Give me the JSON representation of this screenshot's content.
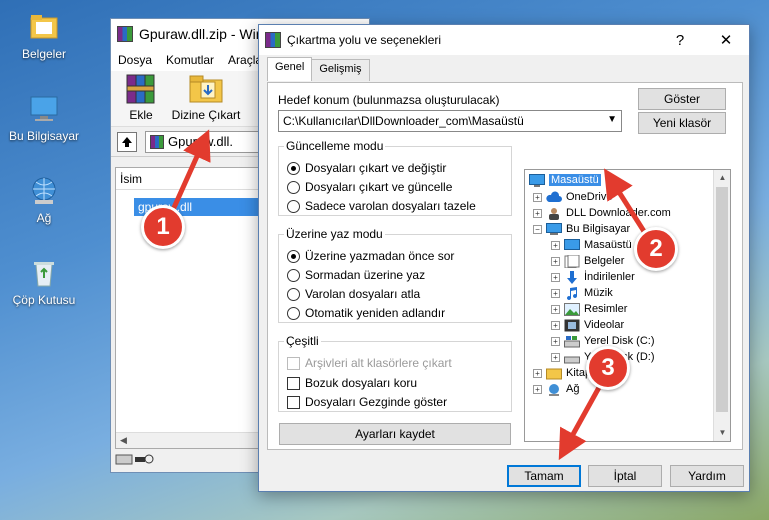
{
  "desktop": {
    "icons": [
      {
        "label": "Belgeler"
      },
      {
        "label": "Bu Bilgisayar"
      },
      {
        "label": "Ağ"
      },
      {
        "label": "Çöp Kutusu"
      }
    ]
  },
  "winrar": {
    "title": "Gpuraw.dll.zip - Win",
    "menu": [
      "Dosya",
      "Komutlar",
      "Araçla"
    ],
    "tools": {
      "add": "Ekle",
      "extract": "Dizine Çıkart"
    },
    "path": "Gpuraw.dll.",
    "list_header": "İsim",
    "file": "gpuraw.dll"
  },
  "dialog": {
    "title": "Çıkartma yolu ve seçenekleri",
    "help": "?",
    "close": "✕",
    "tabs": [
      "Genel",
      "Gelişmiş"
    ],
    "target_label": "Hedef konum (bulunmazsa oluşturulacak)",
    "target_value": "C:\\Kullanıcılar\\DllDownloader_com\\Masaüstü",
    "show_button": "Göster",
    "new_folder_button": "Yeni klasör",
    "update_mode": {
      "title": "Güncelleme modu",
      "options": [
        "Dosyaları çıkart ve değiştir",
        "Dosyaları çıkart ve güncelle",
        "Sadece varolan dosyaları tazele"
      ]
    },
    "overwrite_mode": {
      "title": "Üzerine yaz modu",
      "options": [
        "Üzerine yazmadan önce sor",
        "Sormadan üzerine yaz",
        "Varolan dosyaları atla",
        "Otomatik yeniden adlandır"
      ]
    },
    "misc": {
      "title": "Çeşitli",
      "options": [
        "Arşivleri alt klasörlere çıkart",
        "Bozuk dosyaları koru",
        "Dosyaları Gezginde göster"
      ]
    },
    "save_settings": "Ayarları kaydet",
    "tree": [
      {
        "label": "Masaüstü"
      },
      {
        "label": "OneDrive"
      },
      {
        "label": "DLL Downloader.com"
      },
      {
        "label": "Bu Bilgisayar"
      },
      {
        "label": "Masaüstü"
      },
      {
        "label": "Belgeler"
      },
      {
        "label": "İndirilenler"
      },
      {
        "label": "Müzik"
      },
      {
        "label": "Resimler"
      },
      {
        "label": "Videolar"
      },
      {
        "label": "Yerel Disk (C:)"
      },
      {
        "label": "Yerel Disk (D:)"
      },
      {
        "label": "Kitaplıklar"
      },
      {
        "label": "Ağ"
      }
    ],
    "ok": "Tamam",
    "cancel": "İptal",
    "help_button": "Yardım"
  },
  "annotations": [
    "1",
    "2",
    "3"
  ],
  "colors": {
    "selection": "#3a8ee6",
    "badge": "#e23b2e",
    "primary_border": "#0078d7"
  }
}
